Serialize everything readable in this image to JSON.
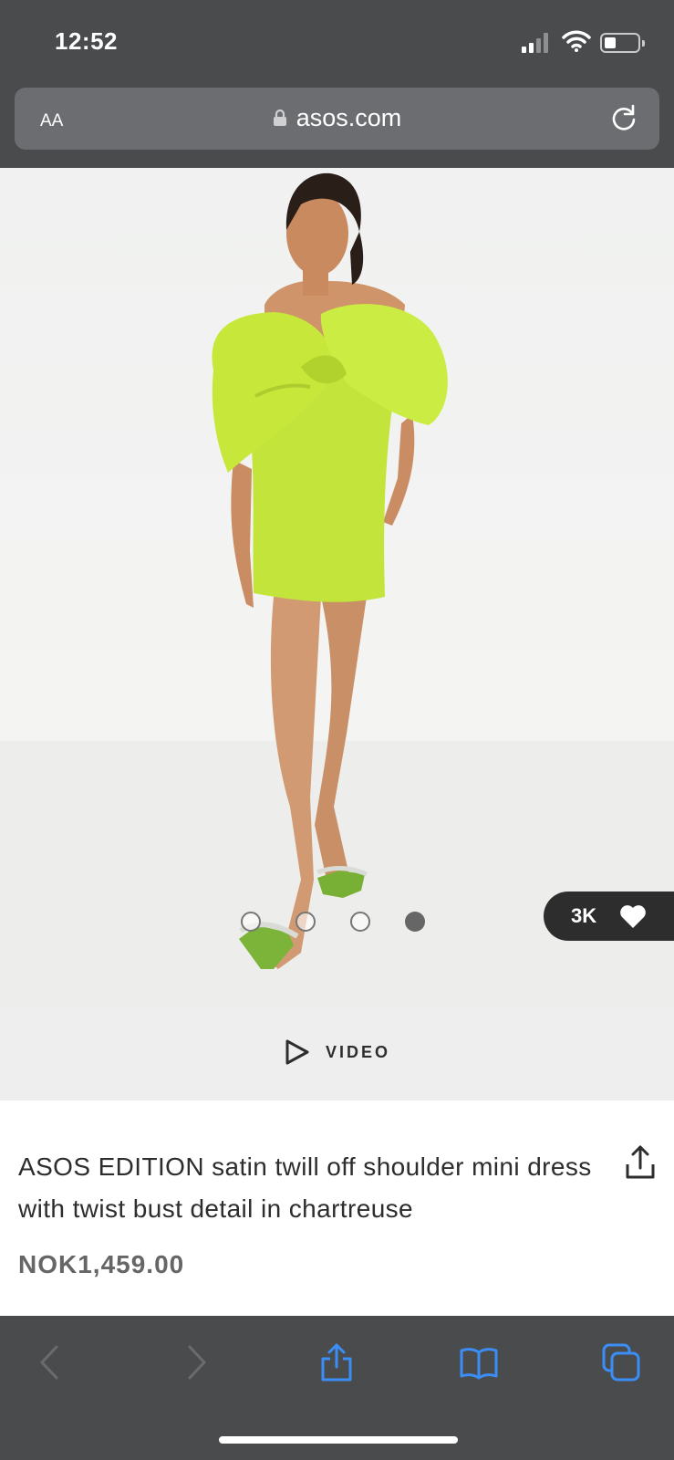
{
  "status": {
    "time": "12:52",
    "icons": [
      "cellular-signal-icon",
      "wifi-icon",
      "battery-icon"
    ]
  },
  "browser": {
    "text_size_label": "AA",
    "domain": "asos.com",
    "icons": [
      "lock-icon",
      "reload-icon"
    ]
  },
  "product": {
    "likes_count": "3K",
    "gallery": {
      "total_images": 4,
      "active_index": 3
    },
    "video_label": "VIDEO",
    "title": "ASOS EDITION satin twill off shoulder mini dress with twist bust detail in chartreuse",
    "price": "NOK1,459.00"
  },
  "toolbar": {
    "items": [
      "back-icon",
      "forward-icon",
      "share-icon",
      "bookmarks-icon",
      "tabs-icon"
    ]
  },
  "colors": {
    "browser_chrome": "#4a4b4d",
    "url_field": "#6c6d70",
    "accent_blue": "#3a8ef6",
    "dress": "#c7e83b",
    "text_dark": "#2d2d2d",
    "price_grey": "#666666"
  }
}
